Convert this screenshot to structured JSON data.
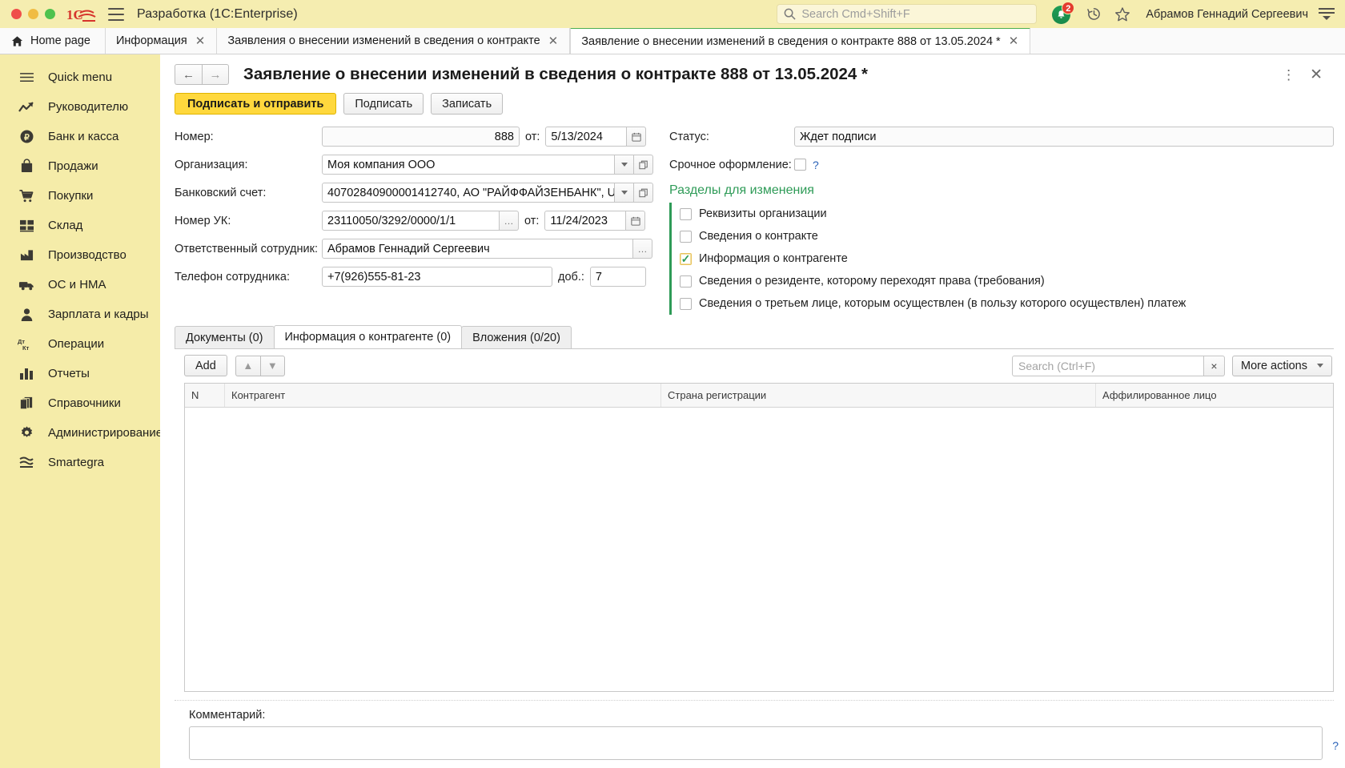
{
  "titlebar": {
    "app_title": "Разработка  (1C:Enterprise)",
    "logo": "1c-logo",
    "search_placeholder": "Search Cmd+Shift+F",
    "notification_count": "2",
    "username": "Абрамов Геннадий Сергеевич",
    "icons": {
      "hamburger": "hamburger-icon",
      "search": "search-icon",
      "bell": "bell-icon",
      "history": "history-clock-icon",
      "favorites": "star-icon",
      "main_menu": "main-menu-icon"
    }
  },
  "tabs": [
    {
      "label": "Home page",
      "closable": false,
      "active": false,
      "icon": "home-icon"
    },
    {
      "label": "Информация",
      "closable": true,
      "active": false
    },
    {
      "label": "Заявления о внесении изменений в сведения о контракте",
      "closable": true,
      "active": false
    },
    {
      "label": "Заявление о внесении изменений в сведения о контракте 888 от 13.05.2024 *",
      "closable": true,
      "active": true
    }
  ],
  "sidebar": {
    "items": [
      {
        "label": "Quick menu",
        "icon": "menu-lines-icon"
      },
      {
        "label": "Руководителю",
        "icon": "trend-arrow-icon"
      },
      {
        "label": "Банк и касса",
        "icon": "ruble-circle-icon"
      },
      {
        "label": "Продажи",
        "icon": "shopping-bag-icon"
      },
      {
        "label": "Покупки",
        "icon": "shopping-cart-icon"
      },
      {
        "label": "Склад",
        "icon": "grid-blocks-icon"
      },
      {
        "label": "Производство",
        "icon": "factory-icon"
      },
      {
        "label": "ОС и НМА",
        "icon": "truck-icon"
      },
      {
        "label": "Зарплата и кадры",
        "icon": "person-icon"
      },
      {
        "label": "Операции",
        "icon": "debit-credit-icon"
      },
      {
        "label": "Отчеты",
        "icon": "bar-chart-icon"
      },
      {
        "label": "Справочники",
        "icon": "books-icon"
      },
      {
        "label": "Администрирование",
        "icon": "gear-icon"
      },
      {
        "label": "Smartegra",
        "icon": "waves-icon"
      }
    ]
  },
  "form": {
    "title": "Заявление о внесении изменений в сведения о контракте 888 от 13.05.2024 *",
    "nav_back": "←",
    "nav_forward": "→",
    "kebab": "⋮",
    "close": "✕",
    "commands": [
      {
        "label": "Подписать и отправить",
        "primary": true
      },
      {
        "label": "Подписать",
        "primary": false
      },
      {
        "label": "Записать",
        "primary": false
      }
    ],
    "fields": {
      "nomer_label": "Номер:",
      "nomer_value": "888",
      "ot_label": "от:",
      "nomer_date": "5/13/2024",
      "org_label": "Организация:",
      "org_value": "Моя компания ООО",
      "account_label": "Банковский счет:",
      "account_value": "40702840900001412740, АО \"РАЙФФАЙЗЕНБАНК\", U",
      "uk_label": "Номер УК:",
      "uk_value": "23110050/3292/0000/1/1",
      "uk_ot_label": "от:",
      "uk_date": "11/24/2023",
      "employee_label": "Ответственный сотрудник:",
      "employee_value": "Абрамов Геннадий Сергеевич",
      "phone_label": "Телефон сотрудника:",
      "phone_value": "+7(926)555-81-23",
      "ext_label": "доб.:",
      "ext_value": "7",
      "status_label": "Статус:",
      "status_value": "Ждет подписи",
      "urgent_label": "Срочное оформление:",
      "urgent_checked": false,
      "urgent_help": "?"
    },
    "sections_title": "Разделы для изменения",
    "sections": [
      {
        "label": "Реквизиты организации",
        "checked": false
      },
      {
        "label": "Сведения о контракте",
        "checked": false
      },
      {
        "label": "Информация о контрагенте",
        "checked": true
      },
      {
        "label": "Сведения о резиденте, которому переходят права (требования)",
        "checked": false
      },
      {
        "label": "Сведения о третьем лице, которым осуществлен (в пользу которого осуществлен) платеж",
        "checked": false
      }
    ],
    "subtabs": [
      {
        "label": "Документы (0)",
        "active": false
      },
      {
        "label": "Информация о контрагенте (0)",
        "active": true
      },
      {
        "label": "Вложения (0/20)",
        "active": false
      }
    ],
    "table_toolbar": {
      "add_label": "Add",
      "move_up": "▲",
      "move_down": "▼",
      "search_placeholder": "Search (Ctrl+F)",
      "search_value": "",
      "clear_label": "×",
      "more_actions_label": "More actions"
    },
    "table": {
      "columns": [
        "N",
        "Контрагент",
        "Страна регистрации",
        "Аффилированное лицо"
      ],
      "rows": []
    },
    "comment_label": "Комментарий:",
    "comment_value": "",
    "bottom_help": "?"
  },
  "colors": {
    "brand_yellow": "#f5eca9",
    "titlebar_yellow": "#f5edb0",
    "primary_button": "#ffd83d",
    "accent_green": "#2e9b57",
    "active_tab_green": "#4caf50",
    "badge_red": "#e43c2e",
    "link_blue": "#2a62b8"
  }
}
